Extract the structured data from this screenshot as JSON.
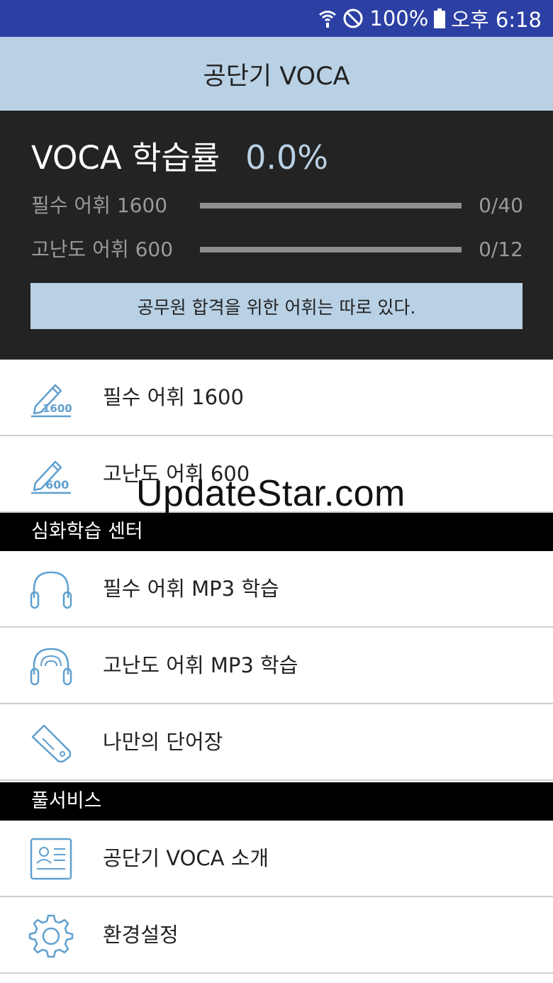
{
  "status_bar": {
    "battery": "100%",
    "time": "오후 6:18",
    "wifi_icon": "wifi-icon",
    "dnd_icon": "do-not-disturb-icon",
    "battery_icon": "battery-icon"
  },
  "header": {
    "title": "공단기 VOCA"
  },
  "stats": {
    "rate_label": "VOCA 학습률",
    "rate_value": "0.0%",
    "rows": [
      {
        "label": "필수 어휘 1600",
        "count": "0/40",
        "progress": 0
      },
      {
        "label": "고난도 어휘 600",
        "count": "0/12",
        "progress": 0
      }
    ],
    "slogan": "공무원 합격을 위한 어휘는 따로 있다."
  },
  "menu_main": [
    {
      "label": "필수 어휘 1600",
      "icon": "pencil-1600-icon",
      "icon_text": "1600"
    },
    {
      "label": "고난도 어휘 600",
      "icon": "pencil-600-icon",
      "icon_text": "600"
    }
  ],
  "section_study": {
    "title": "심화학습 센터"
  },
  "menu_study": [
    {
      "label": "필수 어휘 MP3 학습",
      "icon": "headphones-icon"
    },
    {
      "label": "고난도 어휘 MP3 학습",
      "icon": "headphones-signal-icon"
    },
    {
      "label": "나만의 단어장",
      "icon": "tag-icon"
    }
  ],
  "section_service": {
    "title": "풀서비스"
  },
  "menu_service": [
    {
      "label": "공단기 VOCA 소개",
      "icon": "profile-card-icon"
    },
    {
      "label": "환경설정",
      "icon": "gear-icon"
    }
  ],
  "watermark": "UpdateStar.com",
  "colors": {
    "status_bar": "#2c40a4",
    "header_bg": "#b9d1e5",
    "stats_bg": "#232323",
    "icon_blue": "#5fa0cf",
    "section_bg": "#000000"
  }
}
